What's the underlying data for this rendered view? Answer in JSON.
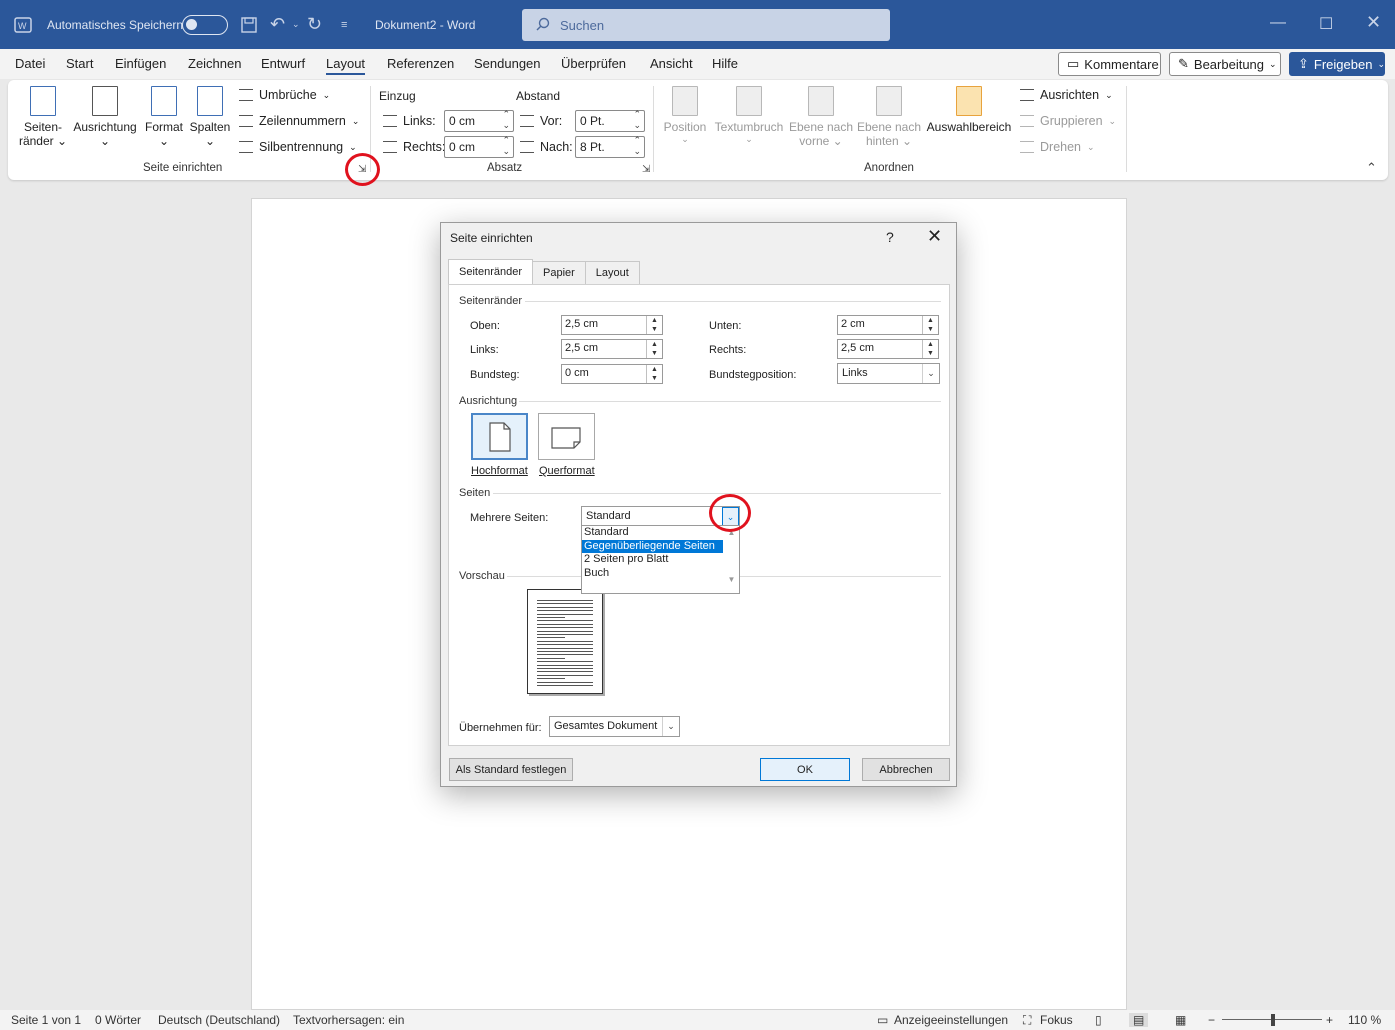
{
  "titlebar": {
    "autosave_label": "Automatisches Speichern",
    "doc_title": "Dokument2 - Word",
    "search_placeholder": "Suchen"
  },
  "menu": {
    "items": [
      "Datei",
      "Start",
      "Einfügen",
      "Zeichnen",
      "Entwurf",
      "Layout",
      "Referenzen",
      "Sendungen",
      "Überprüfen",
      "Ansicht",
      "Hilfe"
    ],
    "active": "Layout",
    "comments": "Kommentare",
    "editing": "Bearbeitung",
    "share": "Freigeben"
  },
  "ribbon": {
    "seitenraender_1": "Seiten-",
    "seitenraender_2": "ränder",
    "ausrichtung": "Ausrichtung",
    "format": "Format",
    "spalten": "Spalten",
    "umbrueche": "Umbrüche",
    "zeilennummern": "Zeilennummern",
    "silbentrennung": "Silbentrennung",
    "group_seite": "Seite einrichten",
    "einzug": "Einzug",
    "abstand": "Abstand",
    "links_label": "Links:",
    "links_value": "0 cm",
    "rechts_label": "Rechts:",
    "rechts_value": "0 cm",
    "vor_label": "Vor:",
    "vor_value": "0 Pt.",
    "nach_label": "Nach:",
    "nach_value": "8 Pt.",
    "group_absatz": "Absatz",
    "position": "Position",
    "textumbruch": "Textumbruch",
    "ebene_vorne_1": "Ebene nach",
    "ebene_vorne_2": "vorne",
    "ebene_hinten_1": "Ebene nach",
    "ebene_hinten_2": "hinten",
    "auswahlbereich": "Auswahlbereich",
    "ausrichten": "Ausrichten",
    "gruppieren": "Gruppieren",
    "drehen": "Drehen",
    "group_anordnen": "Anordnen"
  },
  "dialog": {
    "title": "Seite einrichten",
    "help": "?",
    "tabs": [
      "Seitenränder",
      "Papier",
      "Layout"
    ],
    "sec_margins": "Seitenränder",
    "oben_label": "Oben:",
    "oben_value": "2,5 cm",
    "links_label": "Links:",
    "links_value": "2,5 cm",
    "bundsteg_label": "Bundsteg:",
    "bundsteg_value": "0 cm",
    "unten_label": "Unten:",
    "unten_value": "2 cm",
    "rechts_label": "Rechts:",
    "rechts_value": "2,5 cm",
    "bundstegpos_label": "Bundstegposition:",
    "bundstegpos_value": "Links",
    "sec_orientation": "Ausrichtung",
    "hochformat": "Hochformat",
    "querformat": "Querformat",
    "sec_pages": "Seiten",
    "mehrere_label": "Mehrere Seiten:",
    "mehrere_value": "Standard",
    "options": [
      "Standard",
      "Gegenüberliegende Seiten",
      "2 Seiten pro Blatt",
      "Buch"
    ],
    "selected_option": "Gegenüberliegende Seiten",
    "sec_preview": "Vorschau",
    "apply_label": "Übernehmen für:",
    "apply_value": "Gesamtes Dokument",
    "btn_default": "Als Standard festlegen",
    "btn_ok": "OK",
    "btn_cancel": "Abbrechen"
  },
  "status": {
    "page": "Seite 1 von 1",
    "words": "0 Wörter",
    "language": "Deutsch (Deutschland)",
    "prediction": "Textvorhersagen: ein",
    "display": "Anzeigeeinstellungen",
    "focus": "Fokus",
    "zoom": "110 %"
  },
  "colors": {
    "title_bg": "#2b579a",
    "highlight": "#0078d7",
    "annotation": "#e0121e"
  }
}
